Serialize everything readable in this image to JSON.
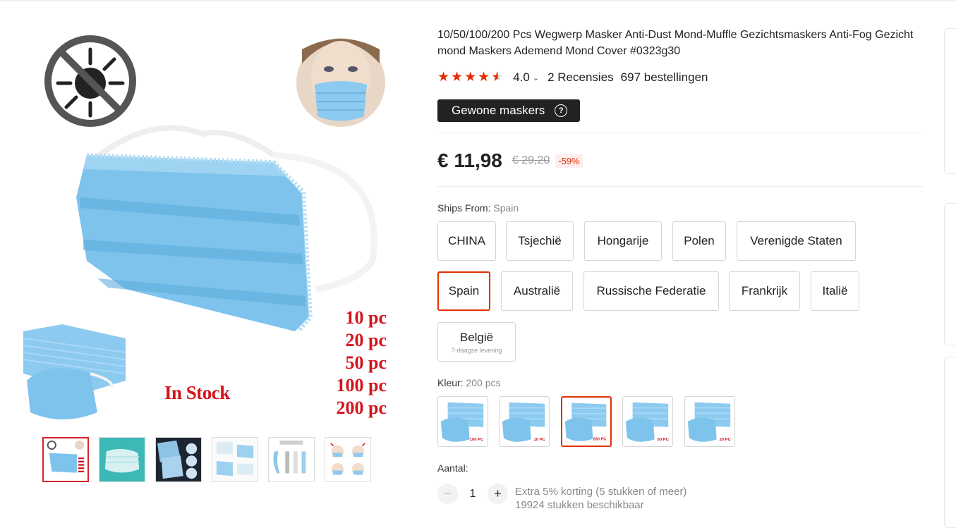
{
  "product": {
    "title": "10/50/100/200 Pcs Wegwerp Masker Anti-Dust Mond-Muffle Gezichtsmaskers Anti-Fog Gezicht mond Maskers Ademend Mond Cover #0323g30",
    "rating_value": "4.0",
    "rating_stars": 4.5,
    "reviews": "2 Recensies",
    "orders": "697 bestellingen",
    "badge": "Gewone maskers",
    "price": "€ 11,98",
    "old_price": "€ 29,20",
    "discount": "-59%"
  },
  "image_overlay": {
    "in_stock": "In Stock",
    "pc_options": [
      "10 pc",
      "20 pc",
      "50 pc",
      "100 pc",
      "200 pc"
    ]
  },
  "thumbnails": [
    "main",
    "mask-teal",
    "mask-stack-dark",
    "mask-detail",
    "3-Layer Protection System",
    "how-to-wear"
  ],
  "ships_from": {
    "label": "Ships From:",
    "selected": "Spain",
    "options": [
      {
        "name": "CHINA"
      },
      {
        "name": "Tsjechië"
      },
      {
        "name": "Hongarije"
      },
      {
        "name": "Polen"
      },
      {
        "name": "Verenigde Staten"
      },
      {
        "name": "Spain"
      },
      {
        "name": "Australië"
      },
      {
        "name": "Russische Federatie"
      },
      {
        "name": "Frankrijk"
      },
      {
        "name": "Italië"
      },
      {
        "name": "België",
        "sub": "7-daagse levering"
      }
    ]
  },
  "color": {
    "label": "Kleur:",
    "selected": "200 pcs",
    "options": [
      "100 PC",
      "10 PC",
      "200 PC",
      "50 PC",
      "20 PC"
    ]
  },
  "quantity": {
    "label": "Aantal:",
    "value": "1",
    "minus": "−",
    "plus": "+",
    "discount_note": "Extra 5% korting (5 stukken of meer)",
    "available": "19924 stukken beschikbaar"
  },
  "icons": {
    "virus": "no-virus-icon",
    "help": "question-circle-icon",
    "caret": "chevron-down-icon",
    "star": "star-icon"
  },
  "colors": {
    "accent": "#e62e04",
    "selected_border": "#e62e04",
    "badge_bg": "#222222",
    "mask_blue": "#7ec3ec"
  }
}
